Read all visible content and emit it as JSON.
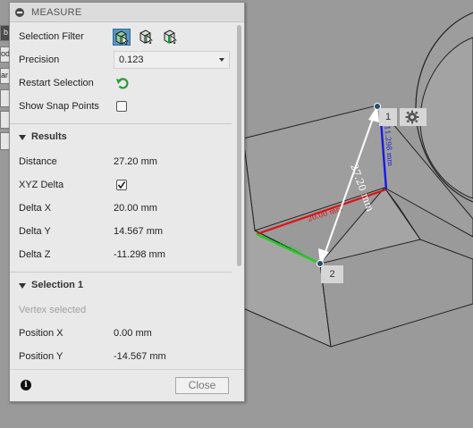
{
  "panel": {
    "title": "MEASURE",
    "selection_filter_label": "Selection Filter",
    "filter_icons": [
      "select-body-filter-icon",
      "select-face-filter-icon",
      "select-edge-filter-icon"
    ],
    "precision_label": "Precision",
    "precision_value": "0.123",
    "restart_label": "Restart Selection",
    "snap_label": "Show Snap Points",
    "snap_checked": false
  },
  "results": {
    "title": "Results",
    "distance_label": "Distance",
    "distance_value": "27.20 mm",
    "xyz_label": "XYZ Delta",
    "xyz_checked": true,
    "dx_label": "Delta X",
    "dx_value": "20.00 mm",
    "dy_label": "Delta Y",
    "dy_value": "14.567 mm",
    "dz_label": "Delta Z",
    "dz_value": "-11.298 mm"
  },
  "selection1": {
    "title": "Selection 1",
    "status": "Vertex selected",
    "posx_label": "Position X",
    "posx_value": "0.00 mm",
    "posy_label": "Position Y",
    "posy_value": "-14.567 mm"
  },
  "footer": {
    "close_label": "Close"
  },
  "canvas": {
    "point1_label": "1",
    "point2_label": "2",
    "dimension_text": "27.20 mm",
    "left_toolbar_letters": [
      "b",
      "od",
      "ar"
    ]
  },
  "colors": {
    "panel_bg": "#e9e9e9",
    "viewport_bg": "#9a9a9a",
    "active_filter": "#5a96c4",
    "delta_x": "#e01010",
    "delta_y": "#22cc22",
    "delta_z": "#1a1ae0"
  }
}
